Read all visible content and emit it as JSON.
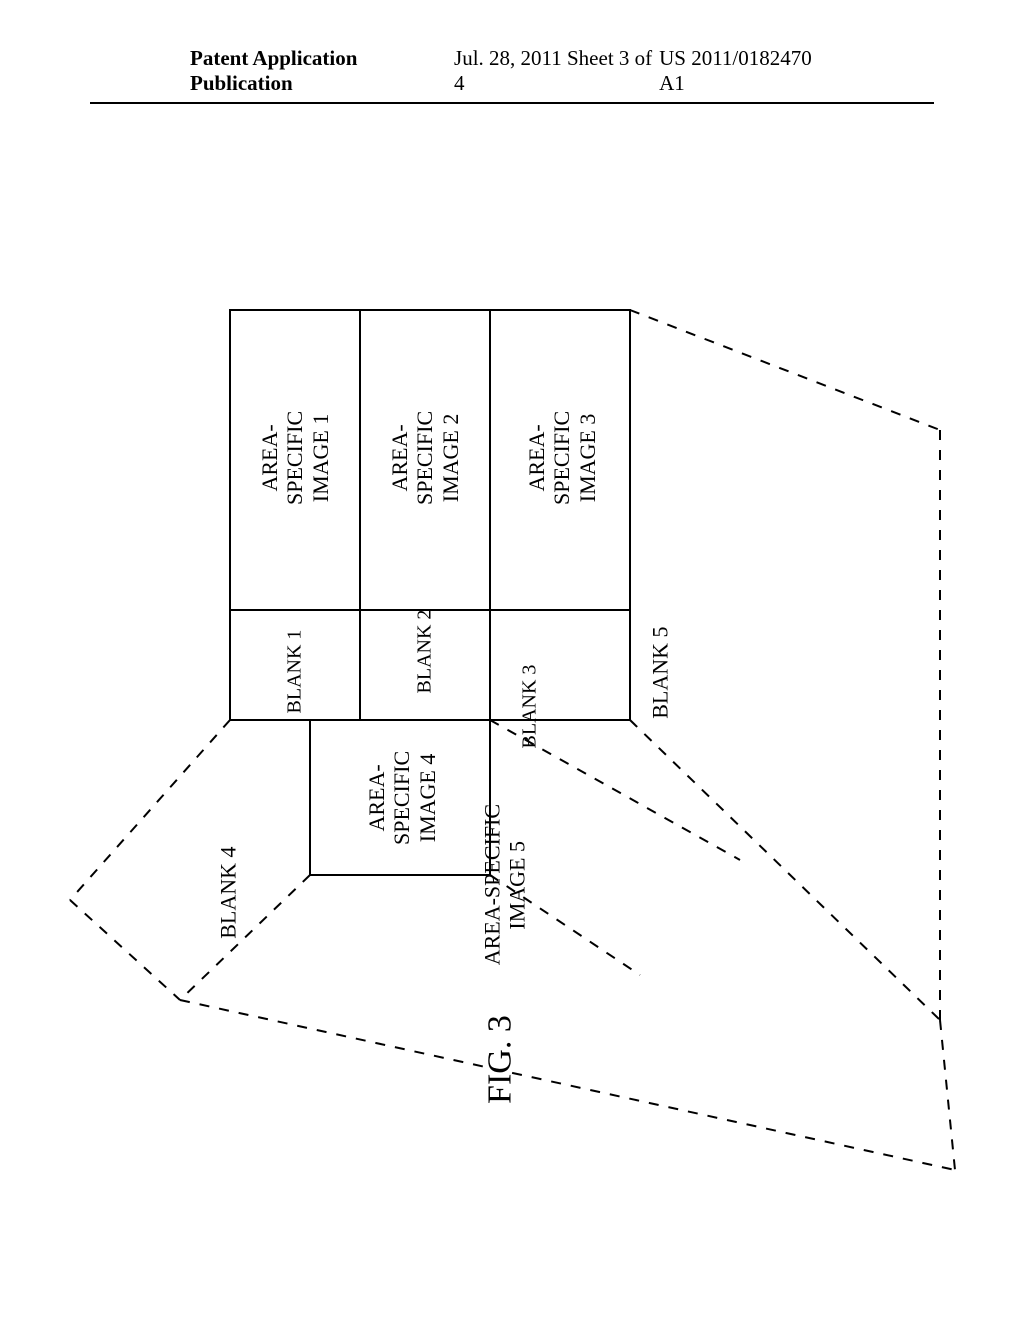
{
  "header": {
    "left": "Patent Application Publication",
    "mid": "Jul. 28, 2011  Sheet 3 of 4",
    "right": "US 2011/0182470 A1"
  },
  "labels": {
    "area1": "AREA-\nSPECIFIC\nIMAGE 1",
    "area2": "AREA-\nSPECIFIC\nIMAGE 2",
    "area3": "AREA-\nSPECIFIC\nIMAGE 3",
    "area4": "AREA-\nSPECIFIC\nIMAGE 4",
    "area5": "AREA-SPECIFIC\nIMAGE 5",
    "blank1": "BLANK 1",
    "blank2": "BLANK 2",
    "blank3": "BLANK 3",
    "blank4": "BLANK 4",
    "blank5": "BLANK 5"
  },
  "caption": "FIG. 3"
}
